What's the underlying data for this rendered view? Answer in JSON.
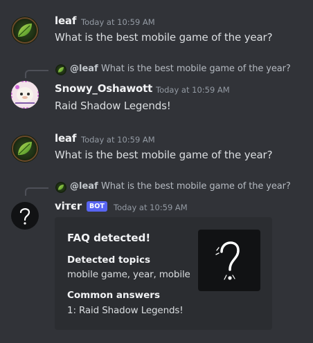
{
  "messages": [
    {
      "author": "leaf",
      "timestamp": "Today at 10:59 AM",
      "content": "What is the best mobile game of the year?",
      "avatar_icon": "leaf-avatar"
    },
    {
      "reply": {
        "mention": "@leaf",
        "text": "What is the best mobile game of the year?"
      },
      "author": "Snowy_Oshawott",
      "timestamp": "Today at 10:59 AM",
      "content": "Raid Shadow Legends!",
      "avatar_icon": "oshawott-avatar"
    },
    {
      "author": "leaf",
      "timestamp": "Today at 10:59 AM",
      "content": "What is the best mobile game of the year?",
      "avatar_icon": "leaf-avatar"
    },
    {
      "reply": {
        "mention": "@leaf",
        "text": "What is the best mobile game of the year?"
      },
      "author": "vітєr",
      "badge": "BOT",
      "timestamp": "Today at 10:59 AM",
      "avatar_icon": "question-mark-avatar",
      "embed": {
        "title": "FAQ detected!",
        "fields": [
          {
            "name": "Detected topics",
            "value": "mobile game, year, mobile"
          },
          {
            "name": "Common answers",
            "value": "1: Raid Shadow Legends!"
          }
        ],
        "thumbnail_icon": "question-mark-thumbnail"
      }
    }
  ],
  "colors": {
    "background": "#313338",
    "embed_background": "#2b2d31",
    "bot_badge": "#5865f2",
    "author_text": "#f2f3f5",
    "timestamp_text": "#949ba4"
  }
}
